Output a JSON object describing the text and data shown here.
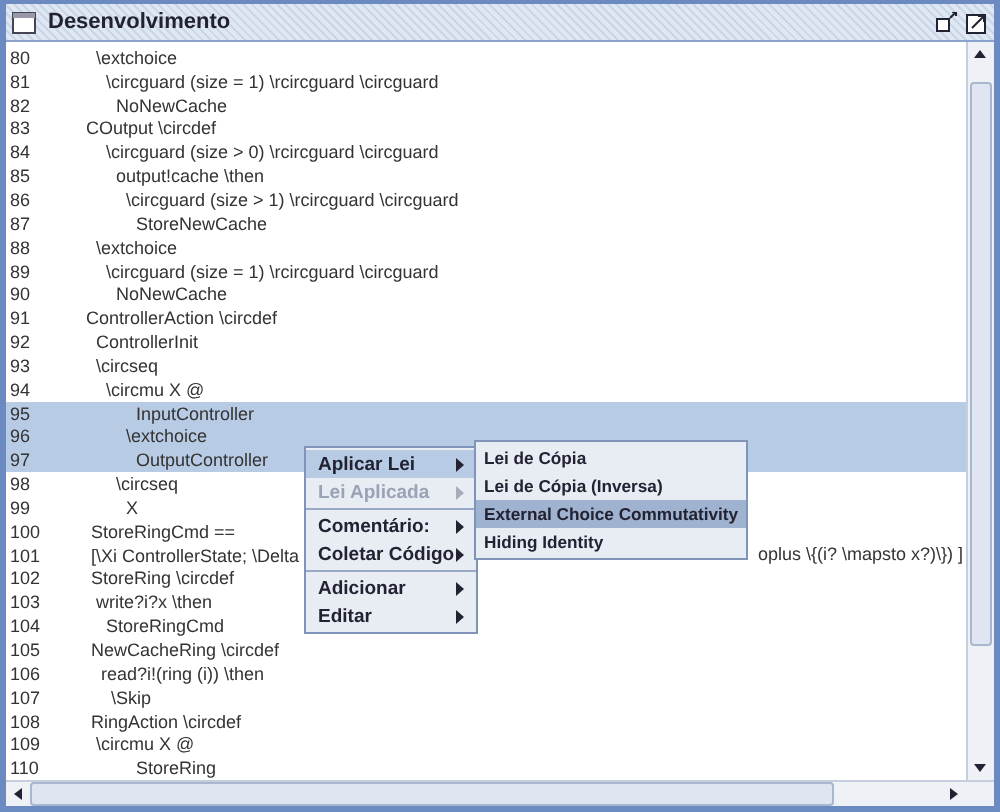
{
  "window": {
    "title": "Desenvolvimento"
  },
  "lines": [
    {
      "number": "80",
      "text": "  \\extchoice",
      "selected": false
    },
    {
      "number": "81",
      "text": "    \\circguard (size = 1) \\rcircguard \\circguard",
      "selected": false
    },
    {
      "number": "82",
      "text": "      NoNewCache",
      "selected": false
    },
    {
      "number": "83",
      "text": "COutput \\circdef",
      "selected": false
    },
    {
      "number": "84",
      "text": "    \\circguard (size > 0) \\rcircguard \\circguard",
      "selected": false
    },
    {
      "number": "85",
      "text": "      output!cache \\then",
      "selected": false
    },
    {
      "number": "86",
      "text": "        \\circguard (size > 1) \\rcircguard \\circguard",
      "selected": false
    },
    {
      "number": "87",
      "text": "          StoreNewCache",
      "selected": false
    },
    {
      "number": "88",
      "text": "  \\extchoice",
      "selected": false
    },
    {
      "number": "89",
      "text": "    \\circguard (size = 1) \\rcircguard \\circguard",
      "selected": false
    },
    {
      "number": "90",
      "text": "      NoNewCache",
      "selected": false
    },
    {
      "number": "91",
      "text": "ControllerAction \\circdef",
      "selected": false
    },
    {
      "number": "92",
      "text": "  ControllerInit",
      "selected": false
    },
    {
      "number": "93",
      "text": "  \\circseq",
      "selected": false
    },
    {
      "number": "94",
      "text": "    \\circmu X @",
      "selected": false
    },
    {
      "number": "95",
      "text": "          InputController",
      "selected": true
    },
    {
      "number": "96",
      "text": "        \\extchoice",
      "selected": true
    },
    {
      "number": "97",
      "text": "          OutputController",
      "selected": true
    },
    {
      "number": "98",
      "text": "      \\circseq",
      "selected": false
    },
    {
      "number": "99",
      "text": "        X",
      "selected": false
    },
    {
      "number": "100",
      "text": " StoreRingCmd ==",
      "selected": false
    },
    {
      "number": "101",
      "text": " [\\Xi ControllerState; \\Delta",
      "tail": "oplus \\{(i? \\mapsto x?)\\}) ]",
      "selected": false
    },
    {
      "number": "102",
      "text": " StoreRing \\circdef",
      "selected": false
    },
    {
      "number": "103",
      "text": "  write?i?x \\then",
      "selected": false
    },
    {
      "number": "104",
      "text": "    StoreRingCmd",
      "selected": false
    },
    {
      "number": "105",
      "text": " NewCacheRing \\circdef",
      "selected": false
    },
    {
      "number": "106",
      "text": "   read?i!(ring (i)) \\then",
      "selected": false
    },
    {
      "number": "107",
      "text": "     \\Skip",
      "selected": false
    },
    {
      "number": "108",
      "text": " RingAction \\circdef",
      "selected": false
    },
    {
      "number": "109",
      "text": "  \\circmu X @",
      "selected": false
    },
    {
      "number": "110",
      "text": "          StoreRing",
      "selected": false
    }
  ],
  "context_menu": [
    {
      "label": "Aplicar Lei",
      "selected": true,
      "disabled": false,
      "separator_before": false
    },
    {
      "label": "Lei Aplicada",
      "selected": false,
      "disabled": true,
      "separator_before": false
    },
    {
      "label": "Comentário:",
      "selected": false,
      "disabled": false,
      "separator_before": true
    },
    {
      "label": "Coletar Código",
      "selected": false,
      "disabled": false,
      "separator_before": false
    },
    {
      "label": "Adicionar",
      "selected": false,
      "disabled": false,
      "separator_before": true
    },
    {
      "label": "Editar",
      "selected": false,
      "disabled": false,
      "separator_before": false
    }
  ],
  "submenu": [
    {
      "label": "Lei de Cópia",
      "selected": false
    },
    {
      "label": "Lei de Cópia (Inversa)",
      "selected": false
    },
    {
      "label": "External Choice Commutativity",
      "selected": true
    },
    {
      "label": "Hiding Identity",
      "selected": false
    }
  ]
}
